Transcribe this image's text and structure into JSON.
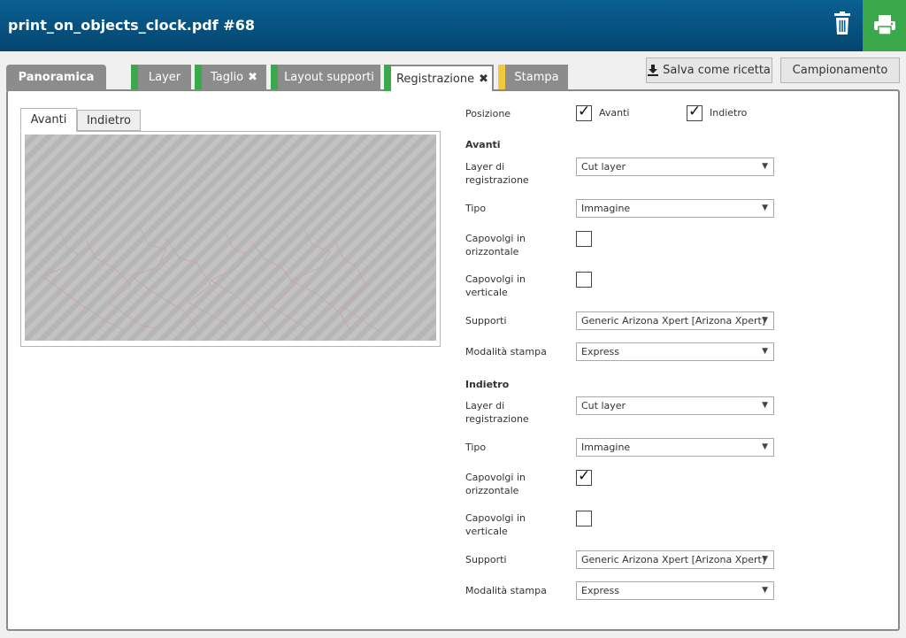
{
  "header": {
    "title": "print_on_objects_clock.pdf #68"
  },
  "tabs": [
    {
      "label": "Panoramica"
    },
    {
      "label": "Layer"
    },
    {
      "label": "Taglio"
    },
    {
      "label": "Layout supporti"
    },
    {
      "label": "Registrazione"
    },
    {
      "label": "Stampa"
    }
  ],
  "tab_marks": {
    "close_glyph": "✖"
  },
  "buttons": {
    "save_recipe": "Salva come ricetta",
    "sampling": "Campionamento"
  },
  "preview": {
    "tabs": [
      "Avanti",
      "Indietro"
    ]
  },
  "form": {
    "position_label": "Posizione",
    "position_front": {
      "label": "Avanti",
      "checked": true
    },
    "position_back": {
      "label": "Indietro",
      "checked": true
    },
    "front": {
      "title": "Avanti",
      "layer_label": "Layer di registrazione",
      "layer_value": "Cut layer",
      "type_label": "Tipo",
      "type_value": "Immagine",
      "flip_h_label": "Capovolgi in orizzontale",
      "flip_h_checked": false,
      "flip_v_label": "Capovolgi in verticale",
      "flip_v_checked": false,
      "media_label": "Supporti",
      "media_value": "Generic Arizona Xpert [Arizona Xpert]",
      "mode_label": "Modalità stampa",
      "mode_value": "Express"
    },
    "back": {
      "title": "Indietro",
      "layer_label": "Layer di registrazione",
      "layer_value": "Cut layer",
      "type_label": "Tipo",
      "type_value": "Immagine",
      "flip_h_label": "Capovolgi in orizzontale",
      "flip_h_checked": true,
      "flip_v_label": "Capovolgi in verticale",
      "flip_v_checked": false,
      "media_label": "Supporti",
      "media_value": "Generic Arizona Xpert [Arizona Xpert]",
      "mode_label": "Modalità stampa",
      "mode_value": "Express"
    }
  },
  "colors": {
    "header": "#04466f",
    "accent_green": "#3aa84b",
    "accent_yellow": "#f3c93b",
    "tab_gray": "#8c8c8c"
  },
  "icons": {
    "trash": "trash-icon",
    "print": "printer-icon",
    "download": "download-icon",
    "close": "close-icon",
    "dropdown": "chevron-down-icon"
  }
}
